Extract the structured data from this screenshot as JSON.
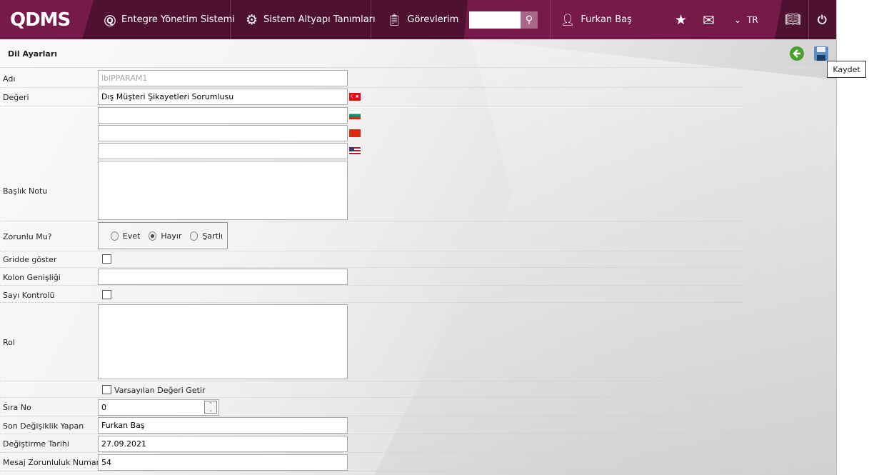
{
  "header": {
    "logo": "QDMS",
    "nav": [
      {
        "label": "Entegre Yönetim Sistemi"
      },
      {
        "label": "Sistem Altyapı Tanımları"
      },
      {
        "label": "Görevlerim"
      }
    ],
    "search_value": "",
    "user": "Furkan Baş",
    "language": "TR"
  },
  "page": {
    "title": "Dil Ayarları",
    "tooltip": "Kaydet"
  },
  "form": {
    "adi_label": "Adı",
    "adi_value": "lblPPARAM1",
    "degeri_label": "Değeri",
    "degeri_tr": "Dış Müşteri Şikayetleri Sorumlusu",
    "degeri_bg": "",
    "degeri_cn": "",
    "degeri_us": "",
    "baslik_label": "Başlık Notu",
    "baslik_value": "",
    "zorunlu_label": "Zorunlu Mu?",
    "zorunlu_options": [
      "Evet",
      "Hayır",
      "Şartlı"
    ],
    "zorunlu_selected": "Hayır",
    "gridde_label": "Gridde göster",
    "gridde_checked": false,
    "kolon_label": "Kolon Genişliği",
    "kolon_value": "",
    "sayi_label": "Sayı Kontrolü",
    "sayi_checked": false,
    "rol_label": "Rol",
    "rol_value": "",
    "varsayilan_label": "Varsayılan Değeri Getir",
    "varsayilan_checked": false,
    "sira_label": "Sıra No",
    "sira_value": "0",
    "son_label": "Son Değişiklik Yapan",
    "son_value": "Furkan Baş",
    "tarih_label": "Değiştirme Tarihi",
    "tarih_value": "27.09.2021",
    "mesaj_label": "Mesaj Zorunluluk Numarası",
    "mesaj_value": "54"
  }
}
